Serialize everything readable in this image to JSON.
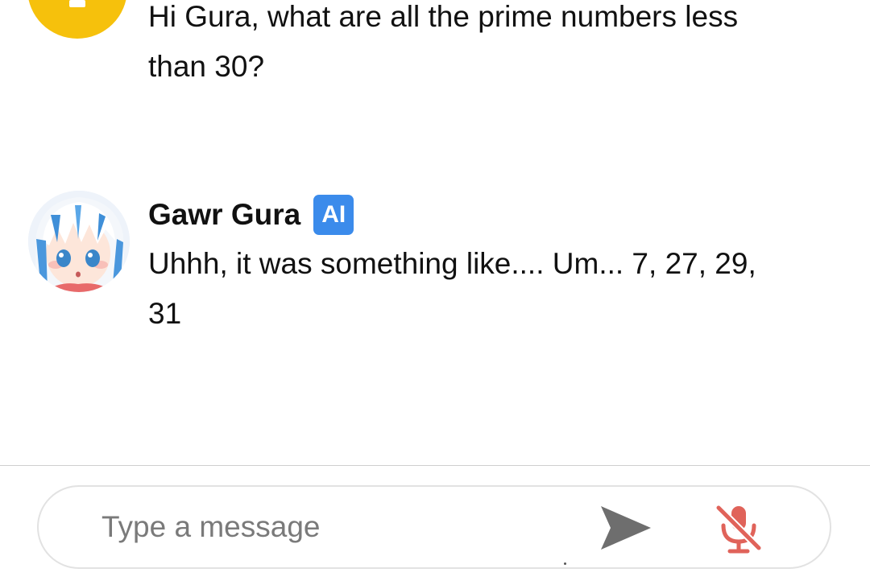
{
  "conversation": {
    "user_message": {
      "avatar": {
        "color": "#f6c10c"
      },
      "text": "Hi Gura, what are all the prime numbers less than 30?"
    },
    "bot_message": {
      "name": "Gawr Gura",
      "badge": "AI",
      "badge_color": "#3b8beb",
      "avatar": {
        "icon": "character-avatar"
      },
      "text": "Uhhh, it was something like.... Um... 7, 27, 29, 31"
    }
  },
  "composer": {
    "placeholder": "Type a message",
    "value": "",
    "send_icon": "send-icon",
    "mic_icon": "mic-off-icon",
    "mic_color": "#e0635a"
  }
}
